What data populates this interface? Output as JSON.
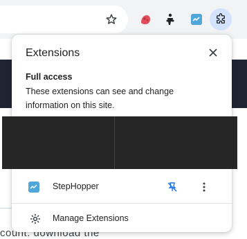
{
  "toolbar": {
    "icons": [
      "star-icon",
      "red-extension-icon",
      "cyclist-extension-icon",
      "stephopper-extension-icon",
      "puzzle-icon"
    ]
  },
  "page": {
    "bottom_text": "count. download the"
  },
  "popup": {
    "title": "Extensions",
    "section_title": "Full access",
    "section_desc": "These extensions can see and change information on this site.",
    "extensions": [
      {
        "name": "StepHopper",
        "icon": "stephopper-icon",
        "pinned": false
      }
    ],
    "manage_label": "Manage Extensions"
  },
  "colors": {
    "accent": "#1a73e8",
    "stephopper": "#4ea6d9",
    "redaction": "#262626"
  }
}
